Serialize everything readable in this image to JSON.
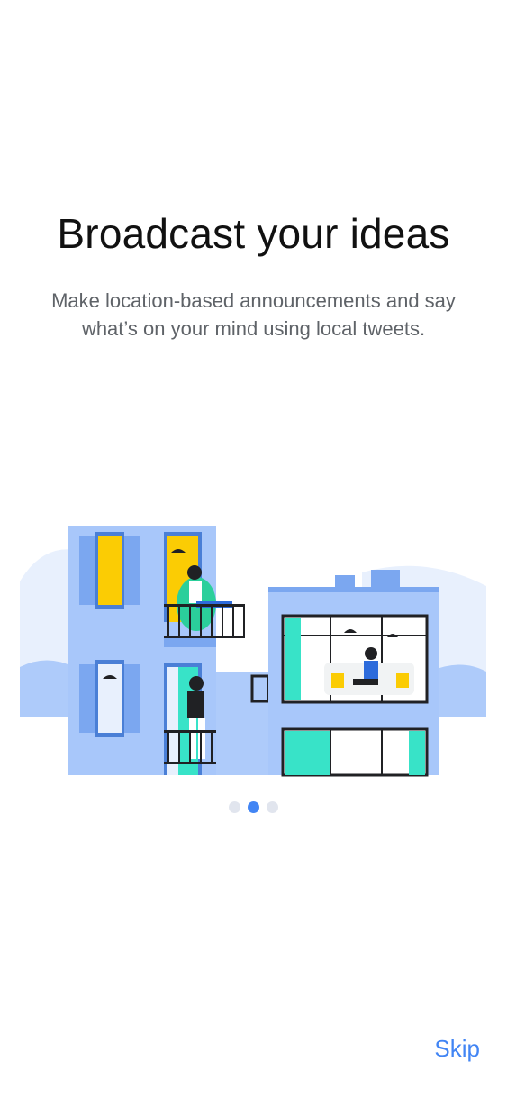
{
  "onboarding": {
    "title": "Broadcast your ideas",
    "subtitle": "Make location-based announcements and say what’s on your mind using local tweets.",
    "illustration_icon": "apartment-buildings-illustration",
    "pagination": {
      "total": 3,
      "current": 2
    },
    "skip_label": "Skip",
    "colors": {
      "accent": "#4285f4",
      "building": "#a8c7fa",
      "window_yellow": "#fbcc04",
      "teal": "#38e3c8"
    }
  }
}
